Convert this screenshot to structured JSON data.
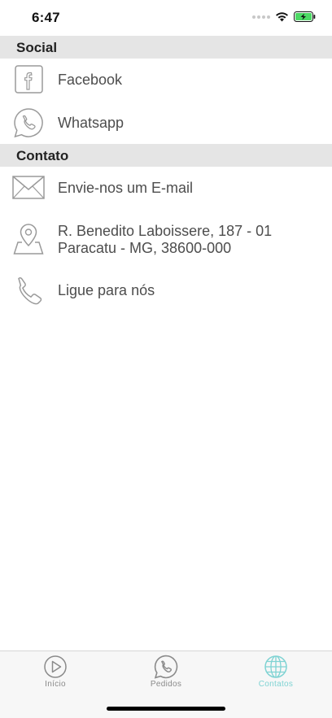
{
  "status_bar": {
    "time": "6:47",
    "icons": [
      "signal-icon",
      "wifi-icon",
      "battery-charging-icon"
    ]
  },
  "sections": {
    "social": {
      "title": "Social",
      "items": [
        {
          "label": "Facebook",
          "icon": "facebook-icon"
        },
        {
          "label": "Whatsapp",
          "icon": "whatsapp-icon"
        }
      ]
    },
    "contato": {
      "title": "Contato",
      "items": [
        {
          "label": "Envie-nos um E-mail",
          "icon": "mail-icon"
        },
        {
          "line1": "R. Benedito Laboissere, 187 - 01",
          "line2": "Paracatu - MG, 38600-000",
          "icon": "map-pin-icon"
        },
        {
          "label": "Ligue para nós",
          "icon": "phone-icon"
        }
      ]
    }
  },
  "tab_bar": {
    "active_color": "#7fd3d3",
    "inactive_color": "#8a8a8a",
    "tabs": [
      {
        "label": "Início",
        "icon": "play-icon",
        "active": false
      },
      {
        "label": "Pedidos",
        "icon": "whatsapp-icon",
        "active": false
      },
      {
        "label": "Contatos",
        "icon": "globe-icon",
        "active": true
      }
    ]
  },
  "colors": {
    "section_header_bg": "#e5e5e5",
    "icon_stroke": "#9a9a9a",
    "battery_fill": "#4cd964"
  }
}
